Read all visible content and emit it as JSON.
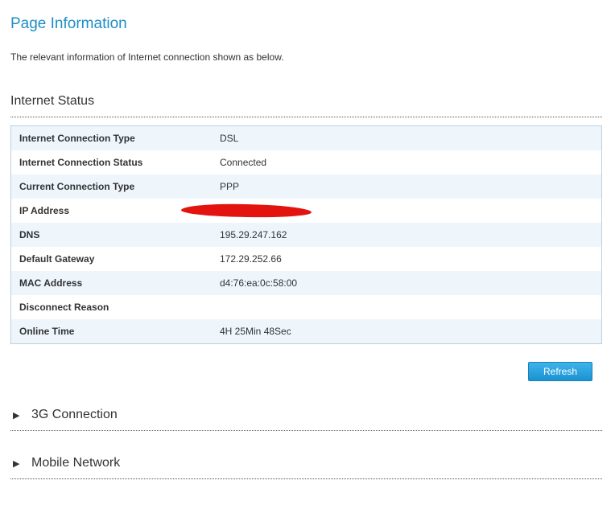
{
  "page": {
    "title": "Page Information",
    "description": "The relevant information of Internet connection shown as below."
  },
  "internet_status": {
    "title": "Internet Status",
    "rows": [
      {
        "label": "Internet Connection Type",
        "value": "DSL"
      },
      {
        "label": "Internet Connection Status",
        "value": "Connected"
      },
      {
        "label": "Current Connection Type",
        "value": "PPP"
      },
      {
        "label": "IP Address",
        "value": ""
      },
      {
        "label": "DNS",
        "value": "195.29.247.162"
      },
      {
        "label": "Default Gateway",
        "value": "172.29.252.66"
      },
      {
        "label": "MAC Address",
        "value": "d4:76:ea:0c:58:00"
      },
      {
        "label": "Disconnect Reason",
        "value": ""
      },
      {
        "label": "Online Time",
        "value": "4H 25Min 48Sec"
      }
    ]
  },
  "actions": {
    "refresh_label": "Refresh"
  },
  "collapsed_sections": [
    {
      "label": "3G Connection",
      "arrow": "▶"
    },
    {
      "label": "Mobile Network",
      "arrow": "▶"
    }
  ],
  "colors": {
    "title": "#1e8fc6",
    "row_alt": "#eef6fc",
    "button": "#1a93d3",
    "redaction": "#e3130f"
  }
}
